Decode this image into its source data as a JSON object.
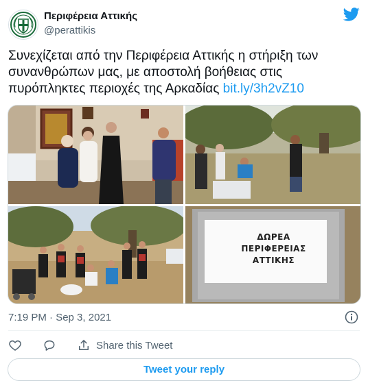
{
  "author": {
    "display_name": "Περιφέρεια Αττικής",
    "handle": "@perattikis",
    "avatar_icon": "region-attica-seal-icon"
  },
  "brand": {
    "icon": "twitter-bird-icon",
    "color": "#1d9bf0"
  },
  "tweet": {
    "text_line1": "Συνεχίζεται από την Περιφέρεια Αττικής η στήριξη των",
    "text_line2": "συνανθρώπων μας, με αποστολή βοήθειας στις",
    "text_line3": "πυρόπληκτες περιοχές της Αρκαδίας ",
    "link": "bit.ly/3h2vZ10"
  },
  "media": {
    "sign": {
      "line1": "ΔΩΡΕΑ",
      "line2": "ΠΕΡΙΦΕΡΕΙΑΣ",
      "line3": "ΑΤΤΙΚΗΣ"
    }
  },
  "meta": {
    "timestamp": "7:19 PM · Sep 3, 2021",
    "info_icon": "info-icon"
  },
  "actions": {
    "like_icon": "heart-icon",
    "reply_icon": "speech-bubble-icon",
    "share_icon": "share-icon",
    "share_label": "Share this Tweet"
  },
  "reply_button": {
    "label": "Tweet your reply"
  }
}
